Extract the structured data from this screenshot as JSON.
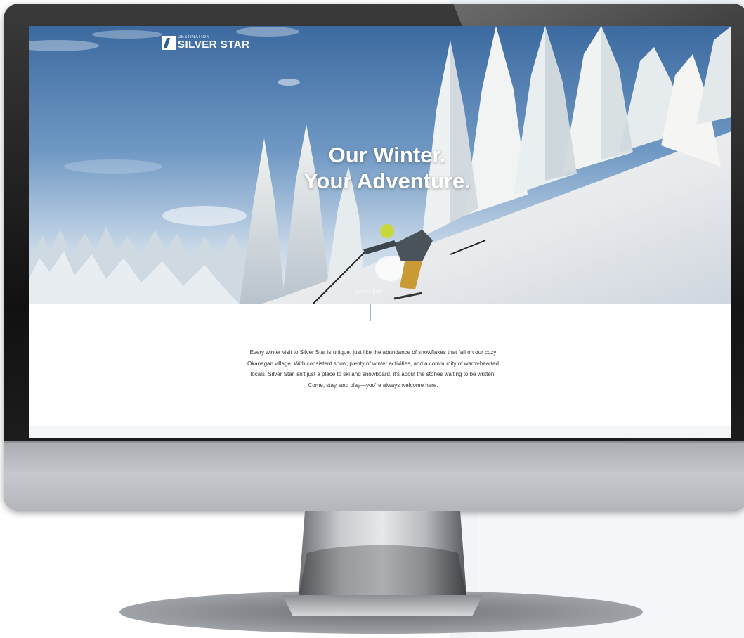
{
  "site": {
    "logo": {
      "small_text": "DESTINATION",
      "big_text": "SILVER STAR",
      "icon": "silver-star-logo-mark"
    },
    "hero": {
      "headline_line1": "Our Winter.",
      "headline_line2": "Your Adventure.",
      "scroll_label": "SCROLL NOW"
    },
    "intro": {
      "text": "Every winter visit to Silver Star is unique, just like the abundance of snowflakes that fall on our cozy Okanagan village. With consistent snow, plenty of winter activities, and a community of warm-hearted locals, Silver Star isn't just a place to ski and snowboard, it's about the stories waiting to be written. Come, stay, and play—you're always welcome here."
    }
  },
  "colors": {
    "sky": "#4f7fb3",
    "snow": "#eef2f6",
    "trees": "#dfe8ef",
    "accent_line": "#9ab3cc",
    "monitor_bezel": "#111111",
    "monitor_chin": "#bfc2c6"
  }
}
